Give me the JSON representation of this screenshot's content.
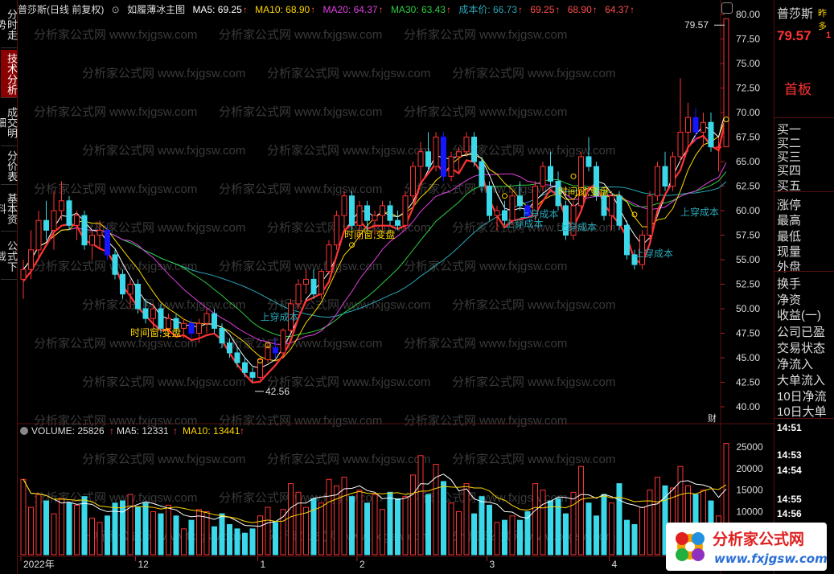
{
  "left_tabs": [
    "分时走势",
    "技术分析",
    "成交明细",
    "分价表",
    "基本资料",
    "公式下载"
  ],
  "active_tab_index": 1,
  "header": {
    "stock": "普莎斯(日线 前复权)",
    "indicator_name": "如履薄冰主图",
    "ma5": "MA5: 69.25",
    "ma10": "MA10: 68.90",
    "ma20": "MA20: 64.37",
    "ma30": "MA30: 63.43",
    "cost": "成本价: 66.73",
    "extra1": "69.25",
    "extra2": "68.90",
    "extra3": "64.37"
  },
  "colors": {
    "ma5": "#ffffff",
    "ma10": "#ffd700",
    "ma20": "#e040e0",
    "ma30": "#2ecc40",
    "cost": "#2aa7b8",
    "up": "#ff3333",
    "down": "#3ad8e8",
    "blue": "#1515ff"
  },
  "price_axis": {
    "ticks": [
      "80.00",
      "77.50",
      "75.00",
      "72.50",
      "70.00",
      "67.50",
      "65.00",
      "62.50",
      "60.00",
      "57.50",
      "55.00",
      "52.50",
      "50.00",
      "47.50",
      "45.00",
      "42.50",
      "40.00"
    ],
    "min": 40,
    "max": 80
  },
  "annotations": {
    "high": "79.57",
    "low": "42.56",
    "signals": [
      "时间窗,变盘",
      "上穿成本",
      "时间窗,变盘",
      "上穿成本",
      "上穿成本",
      "上穿成本",
      "时间窗,变盘",
      "上穿成本",
      "上穿成本"
    ],
    "fin_label": "财"
  },
  "volume_header": {
    "volume": "VOLUME: 25826",
    "ma5": "MA5: 12331",
    "ma10": "MA10: 13441"
  },
  "volume_axis": {
    "ticks": [
      "25000",
      "20000",
      "15000",
      "10000"
    ],
    "max": 28000
  },
  "x_axis": {
    "labels": [
      "2022年",
      "12",
      "1",
      "2",
      "3",
      "4"
    ]
  },
  "watermark": "分析家公式网 www.fxjgsw.com",
  "right_panel": {
    "name": "普莎斯",
    "tag": "昨多",
    "price": "79.57",
    "price_suffix": "1",
    "status": "首板",
    "fields": [
      "买一",
      "买二",
      "买三",
      "买四",
      "买五",
      "涨停",
      "最高",
      "最低",
      "现量",
      "外盘",
      "换手",
      "净资",
      "收益(一)",
      "公司已盈",
      "交易状态",
      "净流入",
      "大单流入",
      "10日净流",
      "10日大单"
    ],
    "times": [
      "14:51",
      "14:53",
      "14:54",
      "14:55",
      "14:56"
    ]
  },
  "logo": {
    "text": "分析家公式网",
    "url": "www.fxjgsw.com"
  },
  "chart_data": {
    "type": "candlestick",
    "ohlc": [
      [
        53,
        55,
        51,
        54
      ],
      [
        54,
        58,
        53,
        56
      ],
      [
        56,
        60,
        55,
        59
      ],
      [
        59,
        61,
        57,
        58
      ],
      [
        58,
        62,
        56,
        60
      ],
      [
        60,
        63,
        59,
        61
      ],
      [
        61,
        61.5,
        58,
        58.5
      ],
      [
        58.5,
        60,
        57,
        59.5
      ],
      [
        59.5,
        60,
        56,
        56.5
      ],
      [
        56.5,
        58,
        55,
        57.5
      ],
      [
        57.5,
        59,
        56,
        58
      ],
      [
        58,
        58.5,
        55,
        55.5
      ],
      [
        55.5,
        56,
        53,
        53.5
      ],
      [
        53.5,
        54,
        51,
        51.5
      ],
      [
        51.5,
        53,
        50,
        52.5
      ],
      [
        52.5,
        53,
        49.5,
        50
      ],
      [
        50,
        51,
        48.5,
        49
      ],
      [
        49,
        50.5,
        48,
        50
      ],
      [
        50,
        50.5,
        47.5,
        48
      ],
      [
        48,
        49.5,
        47,
        49
      ],
      [
        49,
        49.5,
        47.5,
        48
      ],
      [
        48,
        49,
        47,
        48.5
      ],
      [
        48.5,
        49,
        47,
        47.5
      ],
      [
        47.5,
        49,
        46.5,
        48.5
      ],
      [
        48.5,
        50,
        47.5,
        49.5
      ],
      [
        49.5,
        50,
        47.5,
        48
      ],
      [
        48,
        48.5,
        46,
        46.5
      ],
      [
        46.5,
        47,
        45,
        45.5
      ],
      [
        45.5,
        46,
        44,
        44.5
      ],
      [
        44.5,
        45,
        43,
        43.5
      ],
      [
        43.5,
        44,
        42.56,
        43
      ],
      [
        43,
        45,
        42.8,
        44.8
      ],
      [
        44.8,
        46.5,
        44.5,
        46
      ],
      [
        46,
        47,
        45,
        45.5
      ],
      [
        45.5,
        48,
        45.3,
        47.8
      ],
      [
        47.8,
        51,
        47.5,
        50.5
      ],
      [
        50.5,
        53,
        50,
        52.5
      ],
      [
        52.5,
        54,
        51.5,
        53
      ],
      [
        53,
        54,
        51,
        51.5
      ],
      [
        51.5,
        54,
        51,
        53.8
      ],
      [
        53.8,
        57,
        53.5,
        56.5
      ],
      [
        56.5,
        60,
        56,
        59.5
      ],
      [
        59.5,
        62,
        58,
        61.5
      ],
      [
        61.5,
        62,
        58,
        58.5
      ],
      [
        58.5,
        61,
        57,
        60.5
      ],
      [
        60.5,
        61,
        58,
        59
      ],
      [
        59,
        60,
        57.5,
        59.5
      ],
      [
        59.5,
        61,
        58,
        60.5
      ],
      [
        60.5,
        61,
        58.5,
        59
      ],
      [
        59,
        60,
        58,
        58.5
      ],
      [
        58.5,
        62,
        58,
        61.5
      ],
      [
        61.5,
        65,
        61,
        64.5
      ],
      [
        64.5,
        67,
        63,
        66
      ],
      [
        66,
        68,
        64,
        64.5
      ],
      [
        64.5,
        68,
        64,
        67.5
      ],
      [
        67.5,
        68,
        63,
        63.5
      ],
      [
        63.5,
        66,
        63,
        65.5
      ],
      [
        65.5,
        66.5,
        64,
        66
      ],
      [
        66,
        68,
        65.5,
        67.5
      ],
      [
        67.5,
        68,
        64.5,
        65
      ],
      [
        65,
        65.5,
        62,
        62.5
      ],
      [
        62.5,
        63,
        59,
        59.5
      ],
      [
        59.5,
        60.5,
        58,
        60
      ],
      [
        60,
        61,
        58.5,
        59
      ],
      [
        59,
        62,
        58.5,
        61.5
      ],
      [
        61.5,
        63,
        60,
        60.5
      ],
      [
        60.5,
        61,
        59,
        59.5
      ],
      [
        59.5,
        63,
        59,
        62.5
      ],
      [
        62.5,
        65,
        62,
        64.5
      ],
      [
        64.5,
        66,
        62.5,
        63
      ],
      [
        63,
        64,
        60,
        60.5
      ],
      [
        60.5,
        61,
        57,
        57.5
      ],
      [
        57.5,
        61,
        57,
        60.5
      ],
      [
        60.5,
        66,
        60,
        65.5
      ],
      [
        65.5,
        67.5,
        64,
        64.5
      ],
      [
        64.5,
        65,
        61,
        61.5
      ],
      [
        61.5,
        62,
        59,
        59.5
      ],
      [
        59.5,
        62,
        58,
        61.5
      ],
      [
        61.5,
        62,
        58,
        58.5
      ],
      [
        58.5,
        59,
        55,
        55.5
      ],
      [
        55.5,
        56,
        54,
        54.5
      ],
      [
        54.5,
        58,
        54,
        57.5
      ],
      [
        57.5,
        62,
        57,
        61.5
      ],
      [
        61.5,
        65,
        61,
        64.5
      ],
      [
        64.5,
        66,
        62,
        62.5
      ],
      [
        62.5,
        66,
        62,
        65.5
      ],
      [
        65.5,
        73.5,
        65,
        68
      ],
      [
        68,
        71,
        66,
        69.5
      ],
      [
        69.5,
        70.5,
        67,
        68
      ],
      [
        68,
        70,
        66.5,
        69
      ],
      [
        69,
        70,
        66,
        66.5
      ],
      [
        66.5,
        67.5,
        64,
        66.5
      ],
      [
        66.5,
        79.57,
        66.5,
        79.57
      ]
    ],
    "volume": [
      17500,
      11000,
      14000,
      12500,
      9500,
      13000,
      12000,
      11500,
      13500,
      8500,
      7500,
      9000,
      12000,
      12500,
      14000,
      11000,
      12000,
      10000,
      9500,
      11500,
      9000,
      6000,
      8000,
      10500,
      10000,
      6500,
      9500,
      7000,
      6000,
      5000,
      6000,
      9000,
      11000,
      7500,
      10500,
      16500,
      14500,
      11000,
      13000,
      12000,
      17500,
      16000,
      18000,
      13500,
      15000,
      12000,
      14000,
      10500,
      14500,
      13000,
      13500,
      18500,
      23000,
      14000,
      21000,
      17000,
      12000,
      10000,
      16500,
      9500,
      13500,
      11500,
      7500,
      8000,
      9000,
      8000,
      10000,
      16500,
      15000,
      12500,
      13000,
      9500,
      14500,
      20500,
      12000,
      9000,
      14000,
      12000,
      16500,
      8000,
      7000,
      11000,
      15000,
      18000,
      16000,
      15500,
      20500,
      16000,
      14000,
      15000,
      12500,
      9000,
      25826
    ],
    "x_labels": [
      "2022年",
      "12",
      "1",
      "2",
      "3",
      "4"
    ],
    "y_range": [
      40,
      80
    ]
  }
}
